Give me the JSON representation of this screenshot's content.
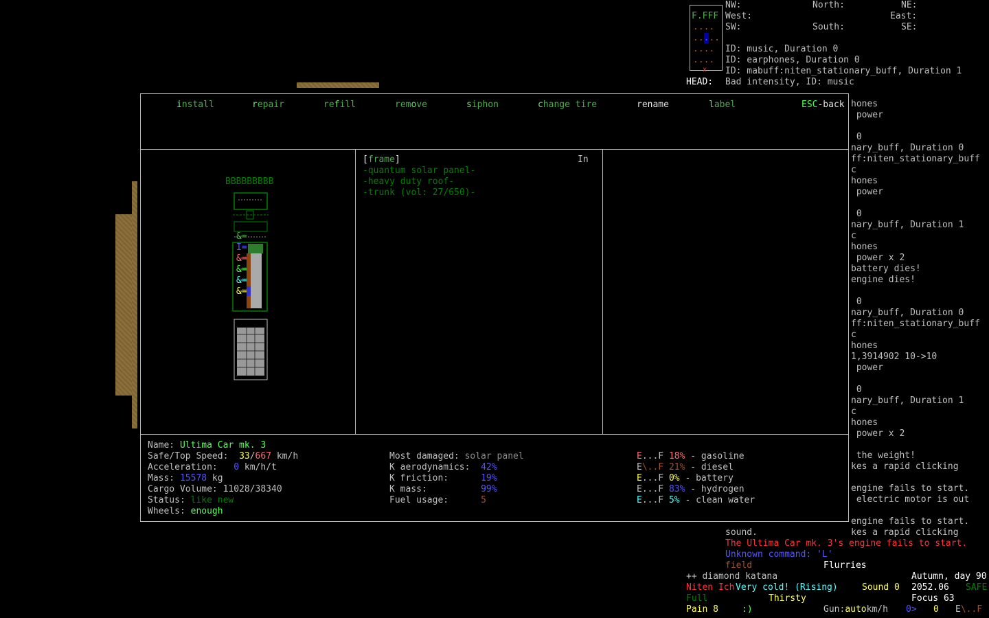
{
  "header": {
    "directions": {
      "nw": "NW:",
      "north": "North:",
      "ne": "NE:",
      "west": "West:",
      "east": "East:",
      "sw": "SW:",
      "south": "South:",
      "se": "SE:"
    },
    "effects": [
      "ID: music, Duration 0",
      "ID: earphones, Duration 0",
      "ID: mabuff:niten_stationary_buff, Duration 1"
    ],
    "head_label": "HEAD:",
    "head_text": "Bad intensity, ID: music",
    "minimap_top": "F.FFF"
  },
  "menu": {
    "install": {
      "prefix": "",
      "key": "i",
      "rest": "nstall"
    },
    "repair": {
      "prefix": "",
      "key": "r",
      "rest": "epair"
    },
    "refill": {
      "prefix": "re",
      "key": "f",
      "rest": "ill"
    },
    "remove": {
      "prefix": "rem",
      "key": "o",
      "rest": "ve"
    },
    "siphon": {
      "prefix": "",
      "key": "s",
      "rest": "iphon"
    },
    "change_tire": {
      "prefix": "",
      "key": "c",
      "rest": "hange tire"
    },
    "rename": {
      "prefix": "re",
      "key": "n",
      "rest": "ame"
    },
    "label": {
      "prefix": "",
      "key": "l",
      "rest": "abel"
    },
    "esc_key": "ESC",
    "esc_rest": "-back"
  },
  "vehicle_art": {
    "top": "BBBBBBBBB"
  },
  "parts": {
    "open": "[",
    "frame": "frame",
    "close": "]",
    "column_label": "In",
    "items": [
      "-quantum solar panel-",
      "-heavy duty roof-",
      "-trunk (vol: 27/650)-"
    ]
  },
  "stats": {
    "name_label": "Name: ",
    "name": "Ultima Car mk. 3",
    "speed_label": "Safe/Top Speed:  ",
    "safe_speed": "33",
    "slash": "/",
    "top_speed": "667",
    "speed_unit": " km/h",
    "accel_label": "Acceleration:   ",
    "accel": "0",
    "accel_unit": " km/h/t",
    "mass_label": "Mass: ",
    "mass": "15578",
    "mass_unit": " kg",
    "cargo": "Cargo Volume: 11028/38340",
    "status_label": "Status: ",
    "status": "like new",
    "wheels_label": "Wheels: ",
    "wheels": "enough",
    "most_damaged_label": "Most damaged: ",
    "most_damaged": "solar panel",
    "k_aero_label": "K aerodynamics:  ",
    "k_aero": "42%",
    "k_friction_label": "K friction:      ",
    "k_friction": "19%",
    "k_mass_label": "K mass:          ",
    "k_mass": "99%",
    "fuel_usage_label": "Fuel usage:      ",
    "fuel_usage": "5"
  },
  "fuels": [
    {
      "gauge_e": "E",
      "gauge_mid": "...F ",
      "pct": "18%",
      "pct_color": "#ff7070",
      "name": " - gasoline",
      "e_color": "#ff7070"
    },
    {
      "gauge_e": "E",
      "gauge_mid": "\\..F ",
      "pct": "21%",
      "pct_color": "#a0522d",
      "name": " - diesel",
      "e_color": "#c0c0c0"
    },
    {
      "gauge_e": "E",
      "gauge_mid": "...F ",
      "pct": "0%",
      "pct_color": "#ffff55",
      "name": " - battery",
      "e_color": "#ffff55"
    },
    {
      "gauge_e": "E",
      "gauge_mid": "...F ",
      "pct": "83%",
      "pct_color": "#5555ff",
      "name": " - hydrogen",
      "e_color": "#c0c0c0"
    },
    {
      "gauge_e": "E",
      "gauge_mid": "...F ",
      "pct": "5%",
      "pct_color": "#55ffff",
      "name": " - clean water",
      "e_color": "#55ffff"
    }
  ],
  "right_log": [
    "hones",
    " power",
    "",
    " 0",
    "nary_buff, Duration 0",
    "ff:niten_stationary_buff",
    "c",
    "hones",
    " power",
    "",
    " 0",
    "nary_buff, Duration 1",
    "c",
    "hones",
    " power x 2",
    "battery dies!",
    "engine dies!",
    "",
    " 0",
    "nary_buff, Duration 0",
    "ff:niten_stationary_buff",
    "c",
    "hones",
    "1,3914902 10->10",
    " power",
    "",
    " 0",
    "nary_buff, Duration 1",
    "c",
    "hones",
    " power x 2",
    "",
    " the weight!",
    "kes a rapid clicking",
    "",
    "engine fails to start.",
    " electric motor is out",
    "",
    "engine fails to start.",
    "kes a rapid clicking"
  ],
  "bottom_log": {
    "sound": "sound.",
    "engine_fail": "The Ultima Car mk. 3's engine fails to start.",
    "unknown_cmd": "Unknown command: 'L'",
    "field": "field",
    "weather": "Flurries",
    "weapon": "++ diamond katana",
    "season": "Autumn, day 90",
    "player_name": "Niten Ich",
    "temp": "Very cold! (Rising)",
    "sound_label": "Sound 0",
    "time": "2052.06",
    "safe": "SAFE",
    "hunger": "Full",
    "thirst": "Thirsty",
    "focus": "Focus 63",
    "pain": "Pain 8",
    "mood": ":)",
    "gun_label": "Gun:",
    "gun_mode": "auto",
    "speed_unit": "km/h",
    "speed_val": "0>",
    "speed_val2": "0",
    "fuel_e": "E",
    "fuel_rest": "\\..F"
  }
}
